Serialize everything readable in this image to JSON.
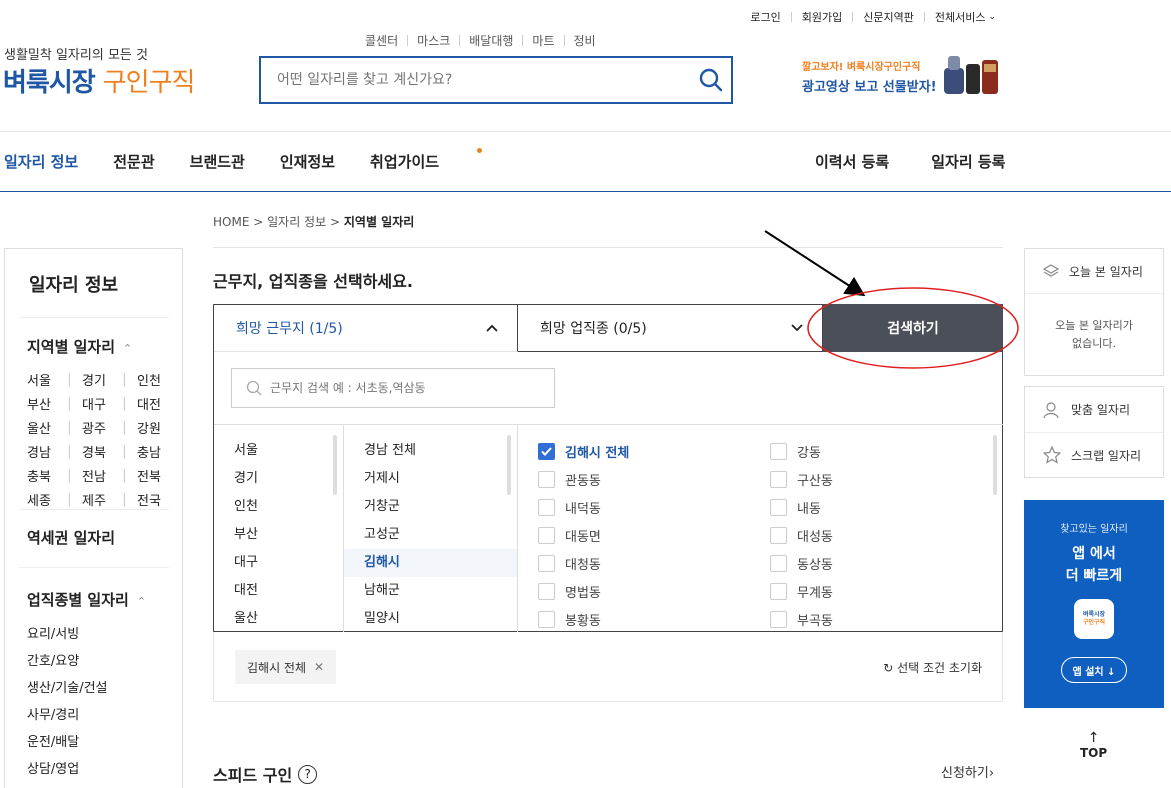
{
  "util": {
    "login": "로그인",
    "join": "회원가입",
    "region_paper": "신문지역판",
    "all_services": "전체서비스"
  },
  "quick": [
    "콜센터",
    "마스크",
    "배달대행",
    "마트",
    "정비"
  ],
  "header": {
    "tagline": "생활밀착 일자리의 모든 것",
    "logo_main": "벼룩시장",
    "logo_sub": "구인구직",
    "search_placeholder": "어떤 일자리를 찾고 계신가요?"
  },
  "promo": {
    "line1": "깔고보자! 벼룩시장구인구직",
    "line2": "광고영상 보고 선물받자!"
  },
  "gnb": {
    "items": [
      "일자리 정보",
      "전문관",
      "브랜드관",
      "인재정보",
      "취업가이드"
    ],
    "right": [
      "이력서 등록",
      "일자리 등록"
    ]
  },
  "breadcrumb": {
    "home": "HOME",
    "sep": ">",
    "level1": "일자리 정보",
    "current": "지역별 일자리"
  },
  "sidebar": {
    "title": "일자리 정보",
    "region_title": "지역별 일자리",
    "regions": [
      [
        "서울",
        "경기",
        "인천"
      ],
      [
        "부산",
        "대구",
        "대전"
      ],
      [
        "울산",
        "광주",
        "강원"
      ],
      [
        "경남",
        "경북",
        "충남"
      ],
      [
        "충북",
        "전남",
        "전북"
      ],
      [
        "세종",
        "제주",
        "전국"
      ]
    ],
    "station_title": "역세권 일자리",
    "job_title": "업직종별 일자리",
    "jobs": [
      "요리/서빙",
      "간호/요양",
      "생산/기술/건설",
      "사무/경리",
      "운전/배달",
      "상담/영업"
    ]
  },
  "main": {
    "title": "근무지, 업직종을 선택하세요.",
    "location_label": "희망 근무지 (1/5)",
    "job_label": "희망 업직종 (0/5)",
    "search_button": "검색하기",
    "local_search_placeholder": "근무지 검색 예 : 서초동,역삼동",
    "regions": [
      "서울",
      "경기",
      "인천",
      "부산",
      "대구",
      "대전",
      "울산"
    ],
    "cities": [
      "경남 전체",
      "거제시",
      "거창군",
      "고성군",
      "김해시",
      "남해군",
      "밀양시"
    ],
    "dongs_left": [
      "김해시 전체",
      "관동동",
      "내덕동",
      "대동면",
      "대청동",
      "명법동",
      "봉황동"
    ],
    "dongs_right": [
      "강동",
      "구산동",
      "내동",
      "대성동",
      "동상동",
      "무계동",
      "부곡동"
    ],
    "selected_chip": "김해시 전체",
    "reset_label": "선택 조건 초기화"
  },
  "speed": {
    "title": "스피드 구인",
    "apply": "신청하기"
  },
  "right": {
    "recent_title": "오늘 본 일자리",
    "recent_empty_1": "오늘 본 일자리가",
    "recent_empty_2": "없습니다.",
    "custom": "맞춤 일자리",
    "scrap": "스크랩 일자리",
    "app_small": "찾고있는 일자리",
    "app_big_1": "앱 에서",
    "app_big_2": "더 빠르게",
    "app_icon_1": "벼룩시장",
    "app_icon_2": "구인구직",
    "app_install": "앱 설치 ↓",
    "top": "TOP"
  },
  "colors": {
    "brand_blue": "#1f57a5",
    "brand_orange": "#f0801f",
    "button_dark": "#4a4f58",
    "annotation_red": "#e02020"
  }
}
